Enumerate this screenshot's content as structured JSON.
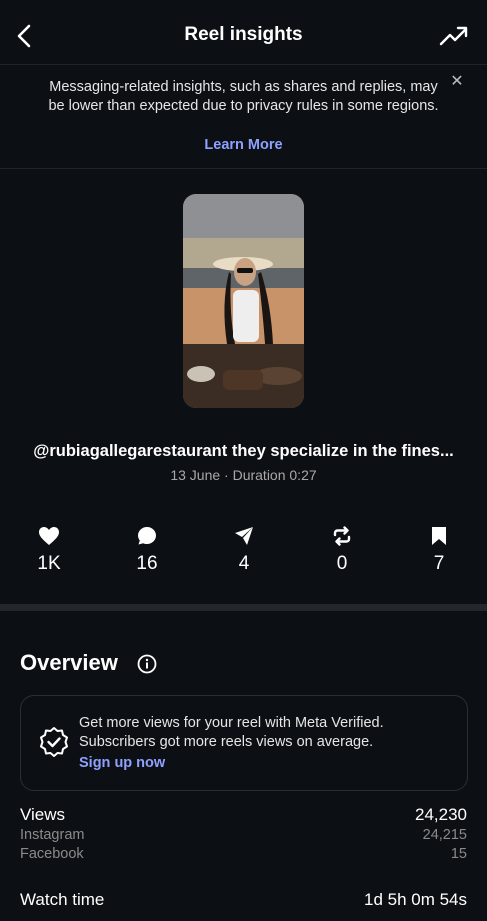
{
  "header": {
    "title": "Reel insights",
    "back_icon": "chevron-left-icon",
    "trend_icon": "trending-up-icon"
  },
  "notice": {
    "message": "Messaging-related insights, such as shares and replies, may be lower than expected due to privacy rules in some regions.",
    "link": "Learn More",
    "close_icon": "close-icon"
  },
  "reel": {
    "caption": "@rubiagallegarestaurant they specialize in the fines...",
    "meta": "13 June · Duration 0:27"
  },
  "stats": [
    {
      "icon": "heart-icon",
      "value": "1K"
    },
    {
      "icon": "comment-icon",
      "value": "16"
    },
    {
      "icon": "send-icon",
      "value": "4"
    },
    {
      "icon": "repost-icon",
      "value": "0"
    },
    {
      "icon": "bookmark-icon",
      "value": "7"
    }
  ],
  "overview": {
    "title": "Overview",
    "info_icon": "info-icon",
    "promo": {
      "text_line1": "Get more views for your reel with Meta Verified.",
      "text_line2": "Subscribers got more reels views on average.",
      "link": "Sign up now",
      "icon": "verified-badge-icon"
    },
    "views": {
      "label": "Views",
      "value": "24,230"
    },
    "instagram": {
      "label": "Instagram",
      "value": "24,215"
    },
    "facebook": {
      "label": "Facebook",
      "value": "15"
    },
    "watch_time": {
      "label": "Watch time",
      "value": "1d 5h 0m 54s"
    }
  },
  "colors": {
    "background": "#0c1014",
    "link": "#8ea1ff",
    "muted": "#a8a8a8"
  }
}
